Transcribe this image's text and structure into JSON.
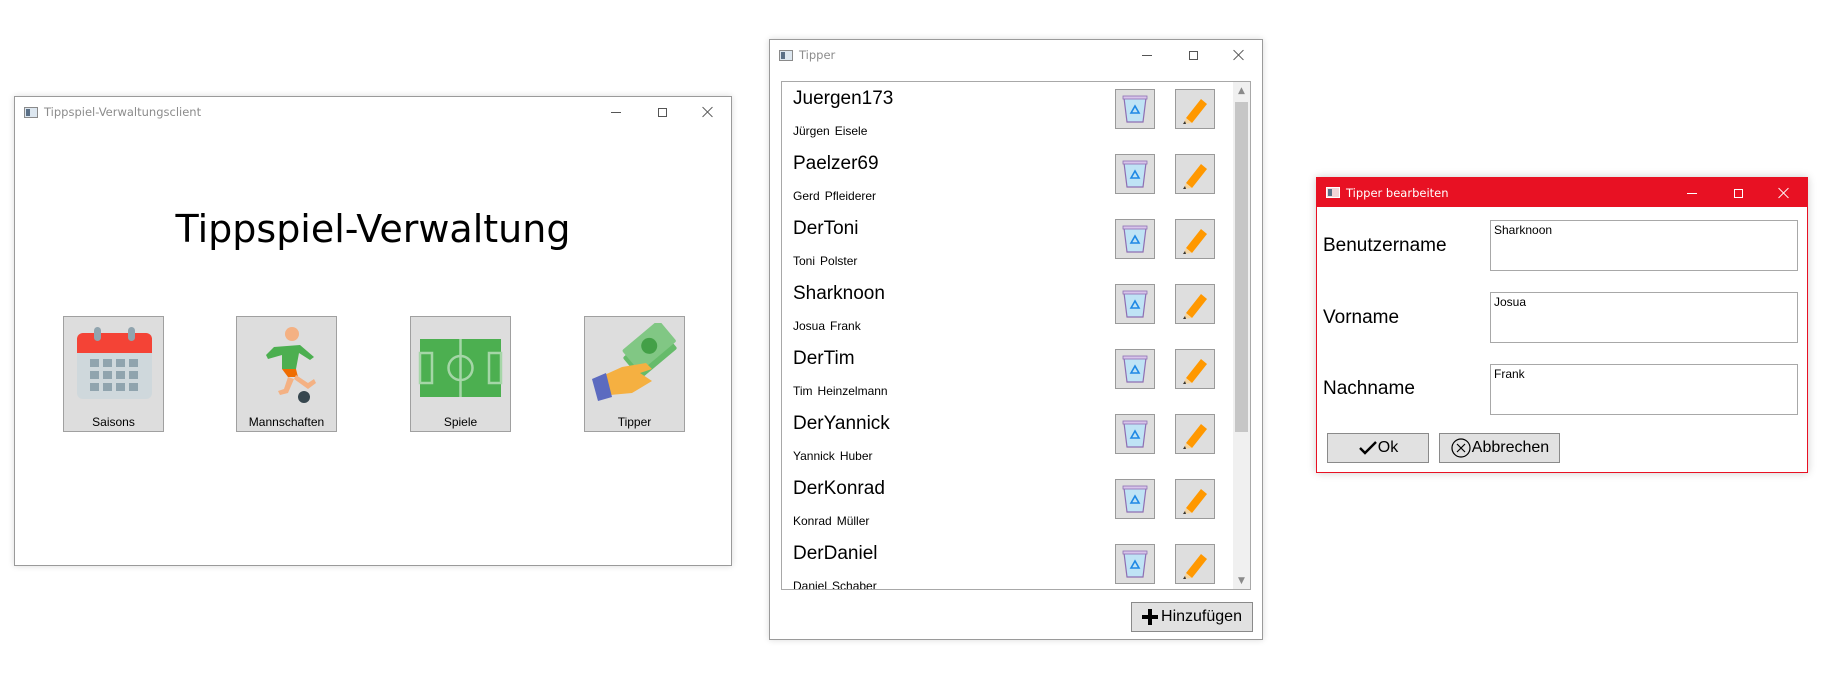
{
  "main_window": {
    "title": "Tippspiel-Verwaltungsclient",
    "heading": "Tippspiel-Verwaltung",
    "tiles": [
      {
        "label": "Saisons",
        "icon": "calendar-icon"
      },
      {
        "label": "Mannschaften",
        "icon": "soccer-player-icon"
      },
      {
        "label": "Spiele",
        "icon": "soccer-field-icon"
      },
      {
        "label": "Tipper",
        "icon": "hand-money-icon"
      }
    ]
  },
  "tipper_window": {
    "title": "Tipper",
    "rows": [
      {
        "username": "Juergen173",
        "first": "Jürgen",
        "last": "Eisele"
      },
      {
        "username": "Paelzer69",
        "first": "Gerd",
        "last": "Pfleiderer"
      },
      {
        "username": "DerToni",
        "first": "Toni",
        "last": "Polster"
      },
      {
        "username": "Sharknoon",
        "first": "Josua",
        "last": "Frank"
      },
      {
        "username": "DerTim",
        "first": "Tim",
        "last": "Heinzelmann"
      },
      {
        "username": "DerYannick",
        "first": "Yannick",
        "last": "Huber"
      },
      {
        "username": "DerKonrad",
        "first": "Konrad",
        "last": "Müller"
      },
      {
        "username": "DerDaniel",
        "first": "Daniel",
        "last": "Schaber"
      }
    ],
    "add_button": "Hinzufügen",
    "delete_icon": "recycle-bin-icon",
    "edit_icon": "pencil-icon"
  },
  "edit_window": {
    "title": "Tipper bearbeiten",
    "fields": [
      {
        "label": "Benutzername",
        "value": "Sharknoon"
      },
      {
        "label": "Vorname",
        "value": "Josua"
      },
      {
        "label": "Nachname",
        "value": "Frank"
      }
    ],
    "ok_button": "Ok",
    "cancel_button": "Abbrechen",
    "accent_color": "#e81123"
  }
}
